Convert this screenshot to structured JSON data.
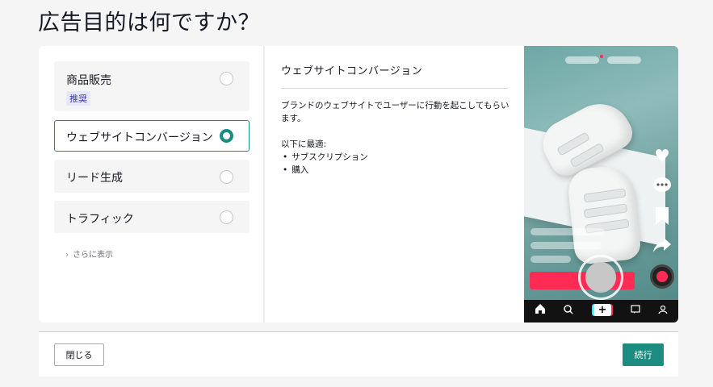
{
  "page_title": "広告目的は何ですか？",
  "options": [
    {
      "label": "商品販売",
      "badge": "推奨",
      "selected": false
    },
    {
      "label": "ウェブサイトコンバージョン",
      "selected": true
    },
    {
      "label": "リード生成",
      "selected": false
    },
    {
      "label": "トラフィック",
      "selected": false
    }
  ],
  "more_link": "さらに表示",
  "detail": {
    "title": "ウェブサイトコンバージョン",
    "description": "ブランドのウェブサイトでユーザーに行動を起こしてもらいます。",
    "best_for_label": "以下に最適:",
    "best_for_items": [
      "サブスクリプション",
      "購入"
    ]
  },
  "footer": {
    "close_label": "閉じる",
    "continue_label": "続行"
  },
  "colors": {
    "accent": "#1c8c80",
    "badge_bg": "#e8e8fb",
    "badge_text": "#3a3aa8",
    "tiktok_red": "#fe2c55"
  },
  "icons": [
    "chevron-right-icon",
    "heart-icon",
    "comment-icon",
    "bookmark-icon",
    "share-icon",
    "music-disc-icon",
    "home-icon",
    "discover-icon",
    "create-icon",
    "inbox-icon",
    "profile-icon"
  ]
}
